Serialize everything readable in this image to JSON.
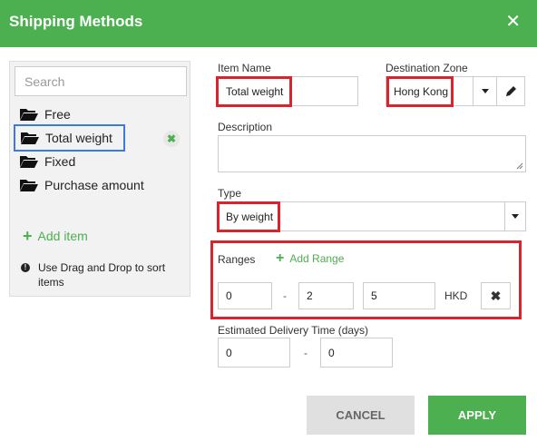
{
  "header": {
    "title": "Shipping Methods",
    "close_glyph": "✕"
  },
  "sidebar": {
    "search_placeholder": "Search",
    "items": [
      {
        "label": "Free"
      },
      {
        "label": "Total weight",
        "selected": true
      },
      {
        "label": "Fixed"
      },
      {
        "label": "Purchase amount"
      }
    ],
    "add_item_label": "Add item",
    "hint": "Use Drag and Drop to sort items",
    "remove_glyph": "✖"
  },
  "form": {
    "item_name_label": "Item Name",
    "item_name_value": "Total weight",
    "destination_label": "Destination Zone",
    "destination_value": "Hong Kong",
    "description_label": "Description",
    "type_label": "Type",
    "type_value": "By weight",
    "ranges_label": "Ranges",
    "add_range_label": "Add Range",
    "range_from": "0",
    "range_to": "2",
    "range_price": "5",
    "currency": "HKD",
    "dash": "-",
    "remove_range_glyph": "✖",
    "delivery_label": "Estimated Delivery Time (days)",
    "delivery_from": "0",
    "delivery_to": "0"
  },
  "buttons": {
    "cancel": "CANCEL",
    "apply": "APPLY"
  },
  "colors": {
    "accent": "#4caf50",
    "highlight": "#d9232d",
    "selection": "#3d7cd6"
  }
}
